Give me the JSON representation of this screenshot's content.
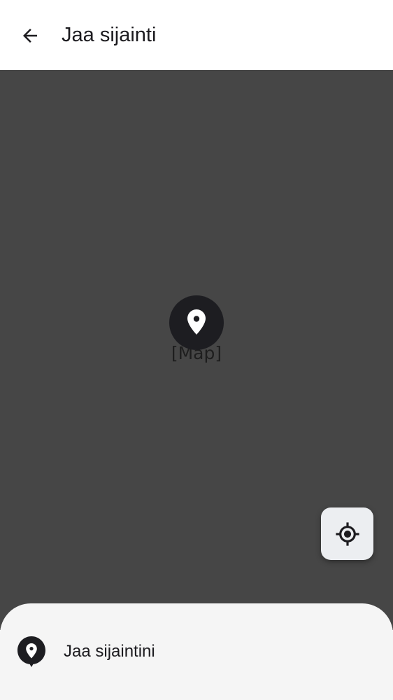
{
  "header": {
    "back_icon": "arrow-back-icon",
    "title": "Jaa sijainti"
  },
  "map": {
    "placeholder": "[Map]",
    "marker_icon": "location-pin-icon",
    "background_color": "#464646",
    "locate_icon": "my-location-icon"
  },
  "sheet": {
    "share_icon": "location-pin-icon",
    "share_label": "Jaa sijaintini"
  }
}
